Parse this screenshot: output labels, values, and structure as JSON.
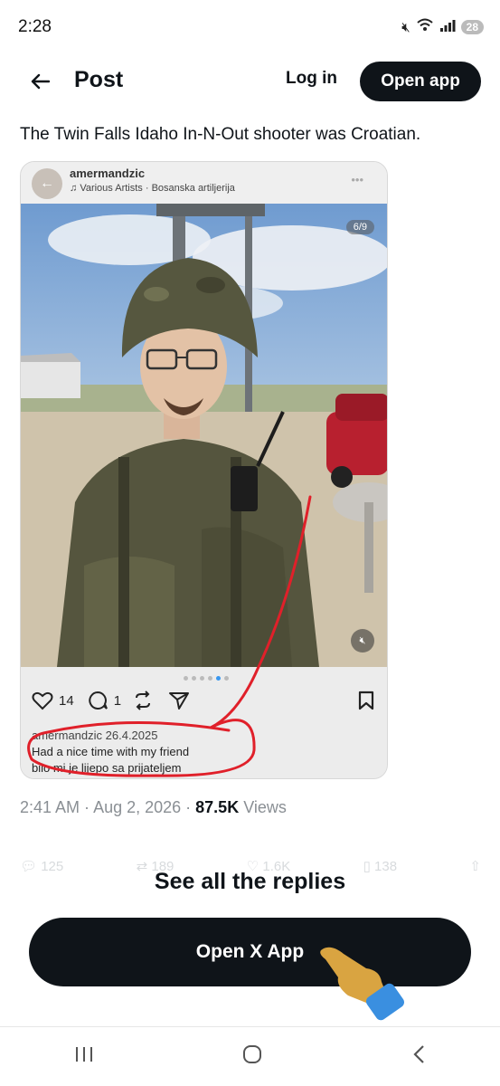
{
  "status": {
    "time": "2:28",
    "battery": "28"
  },
  "nav": {
    "back_icon": "back-arrow-icon",
    "title": "Post",
    "login": "Log in",
    "open_app": "Open app"
  },
  "tweet": {
    "text": "The Twin Falls Idaho In-N-Out shooter was Croatian."
  },
  "embed": {
    "username": "amermandzic",
    "music": "Various Artists · Bosanska artiljerija",
    "page_badge": "6/9",
    "likes": "14",
    "comments": "1",
    "caption_user_date": "amermandzic 26.4.2025",
    "caption_line1": "Had a nice time with my friend",
    "caption_line2": "bilo mi je lijepo sa prijateljem"
  },
  "meta": {
    "time": "2:41 AM",
    "date": "Aug 2, 2026",
    "views_count": "87.5K",
    "views_label": "Views"
  },
  "actions": {
    "replies": "125",
    "reposts": "189",
    "likes": "1.6K",
    "bookmarks": "138"
  },
  "cta": {
    "see_all": "See all the replies",
    "open_x_app": "Open X App"
  },
  "colors": {
    "brand_dark": "#0f1419",
    "annotation_red": "#e0202a",
    "meta_gray": "#8a8f94"
  }
}
